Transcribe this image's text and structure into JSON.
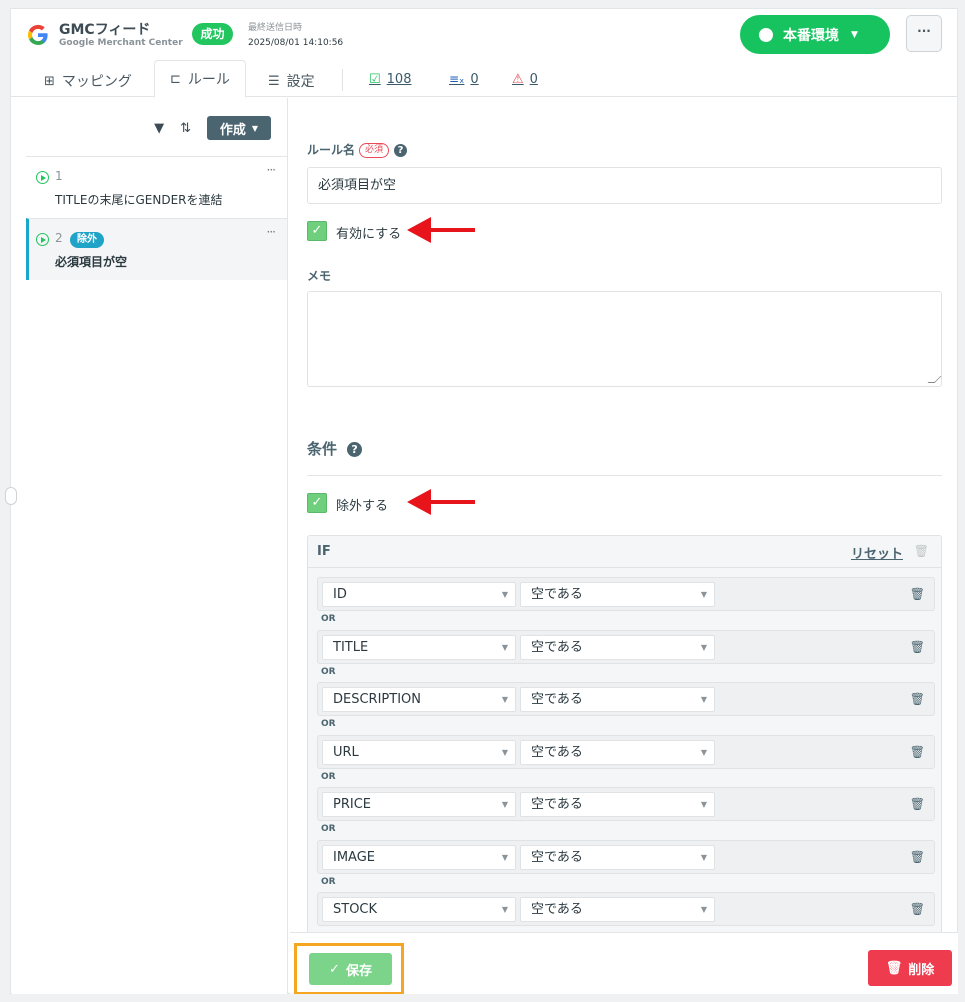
{
  "header": {
    "feed_title": "GMCフィード",
    "feed_subtitle": "Google Merchant Center",
    "status_badge": "成功",
    "last_sent_label": "最終送信日時",
    "last_sent_time": "2025/08/01 14:10:56",
    "env_button": "本番環境",
    "more_button": "···"
  },
  "tabs": [
    {
      "label": "マッピング",
      "icon": "table-icon"
    },
    {
      "label": "ルール",
      "icon": "rule-tree-icon",
      "active": true
    },
    {
      "label": "設定",
      "icon": "sliders-icon"
    }
  ],
  "stats": [
    {
      "value": "108",
      "icon": "check-list-icon",
      "color": "#22c55e"
    },
    {
      "value": "0",
      "icon": "list-x-icon",
      "color": "#1a5fb4"
    },
    {
      "value": "0",
      "icon": "warning-icon",
      "color": "#e84b57"
    }
  ],
  "sidebar": {
    "create_button": "作成",
    "rules": [
      {
        "num": "1",
        "name": "TITLEの末尾にGENDERを連結",
        "badge": ""
      },
      {
        "num": "2",
        "name": "必須項目が空",
        "badge": "除外",
        "selected": true
      }
    ],
    "rule_menu": "···"
  },
  "form": {
    "rule_name_label": "ルール名",
    "required_tag": "必須",
    "help_mark": "?",
    "rule_name_value": "必須項目が空",
    "enable_label": "有効にする",
    "enable_checked": true,
    "memo_label": "メモ",
    "memo_value": "",
    "conditions_title": "条件",
    "exclude_label": "除外する",
    "exclude_checked": true,
    "if_label": "IF",
    "reset_label": "リセット",
    "or_label": "OR",
    "conditions": [
      {
        "field": "ID",
        "operator": "空である"
      },
      {
        "field": "TITLE",
        "operator": "空である"
      },
      {
        "field": "DESCRIPTION",
        "operator": "空である"
      },
      {
        "field": "URL",
        "operator": "空である"
      },
      {
        "field": "PRICE",
        "operator": "空である"
      },
      {
        "field": "IMAGE",
        "operator": "空である"
      },
      {
        "field": "STOCK",
        "operator": "空である"
      }
    ]
  },
  "footer": {
    "save_button": "保存",
    "delete_button": "削除"
  },
  "colors": {
    "accent_green": "#16c35f",
    "accent_teal": "#4a6470",
    "danger": "#ef3b4e",
    "highlight_orange": "#f5a623",
    "annotation_arrow": "#e8141b"
  }
}
